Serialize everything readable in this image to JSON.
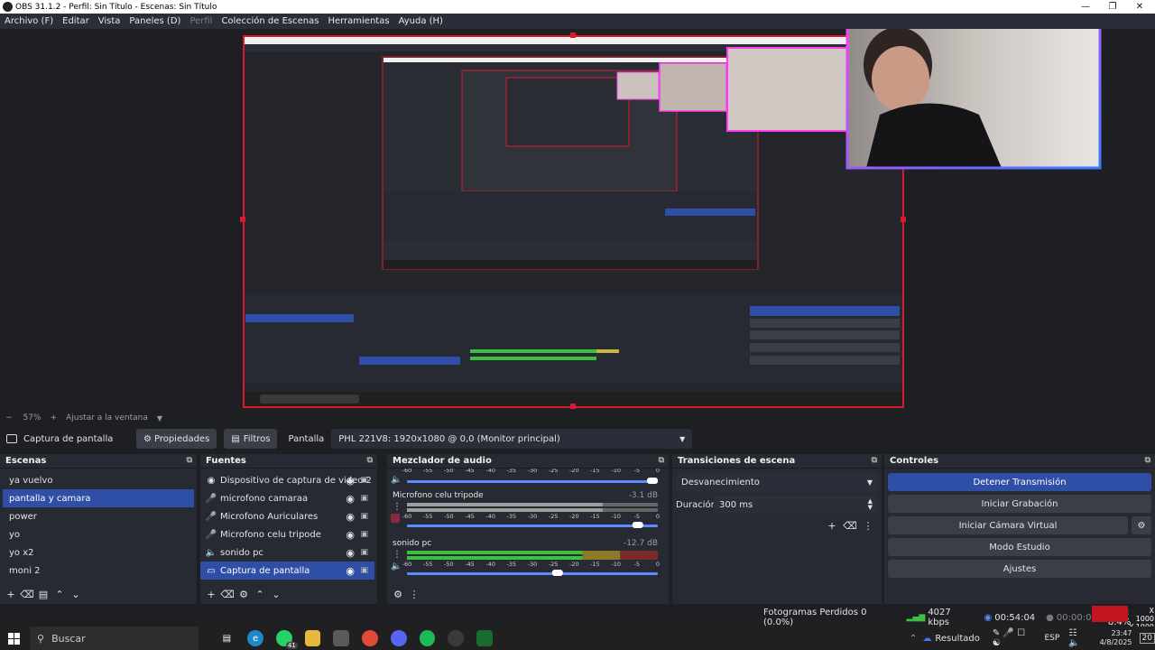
{
  "window": {
    "title": "OBS 31.1.2 - Perfil: Sin Título - Escenas: Sin Título"
  },
  "menu": [
    "Archivo (F)",
    "Editar",
    "Vista",
    "Paneles (D)",
    "Perfil",
    "Colección de Escenas",
    "Herramientas",
    "Ayuda (H)"
  ],
  "zoom": {
    "level": "57%",
    "fit_label": "Ajustar a la ventana"
  },
  "source_toolbar": {
    "source_name": "Captura de pantalla",
    "properties": "Propiedades",
    "filters": "Filtros",
    "display_label": "Pantalla",
    "display_value": "PHL 221V8: 1920x1080 @ 0,0 (Monitor principal)"
  },
  "scenes": {
    "title": "Escenas",
    "items": [
      "ya vuelvo",
      "pantalla y camara",
      "power",
      "yo",
      "yo x2",
      "moni 2"
    ],
    "selected": 1
  },
  "sources": {
    "title": "Fuentes",
    "items": [
      {
        "label": "Dispositivo de captura de video 2",
        "icon": "camera-icon"
      },
      {
        "label": "microfono camaraa",
        "icon": "microphone-icon"
      },
      {
        "label": "Microfono Auriculares",
        "icon": "microphone-icon"
      },
      {
        "label": "Microfono celu tripode",
        "icon": "microphone-icon"
      },
      {
        "label": "sonido pc",
        "icon": "speaker-icon"
      },
      {
        "label": "Captura de pantalla",
        "icon": "monitor-icon"
      }
    ],
    "selected": 5
  },
  "mixer": {
    "title": "Mezclador de audio",
    "scale": [
      "-60",
      "-55",
      "-50",
      "-45",
      "-40",
      "-35",
      "-30",
      "-25",
      "-20",
      "-15",
      "-10",
      "-5",
      "0"
    ],
    "tracks": [
      {
        "name": "Microfono celu tripode",
        "db": "-3.1 dB",
        "volume": 0.92,
        "level": 0.78
      },
      {
        "name": "sonido pc",
        "db": "-12.7 dB",
        "volume": 0.6,
        "level": 0.7
      }
    ]
  },
  "transitions": {
    "title": "Transiciones de escena",
    "selected": "Desvanecimiento",
    "duration_label": "Duración",
    "duration_value": "300 ms"
  },
  "controls": {
    "title": "Controles",
    "buttons": [
      "Detener Transmisión",
      "Iniciar Grabación",
      "Iniciar Cámara Virtual",
      "Modo Estudio",
      "Ajustes"
    ]
  },
  "status": {
    "dropped": "Fotogramas Perdidos 0 (0.0%)",
    "bitrate": "4027 kbps",
    "stream_time": "00:54:04",
    "record_time": "00:00:00",
    "cpu": "CPU: 8.4%",
    "x": "X 1000",
    "y": "Y 1000"
  },
  "taskbar": {
    "search": "Buscar",
    "result": "Resultado",
    "lang": "ESP",
    "time": "23:47",
    "date": "4/8/2025",
    "notif": "20",
    "whatsapp_badge": "41"
  },
  "colors": {
    "accent": "#2f4ea5",
    "dock": "#272a33",
    "bg": "#1e1f22",
    "neon_pink": "#ff3ef2",
    "neon_blue": "#3a7bff"
  }
}
